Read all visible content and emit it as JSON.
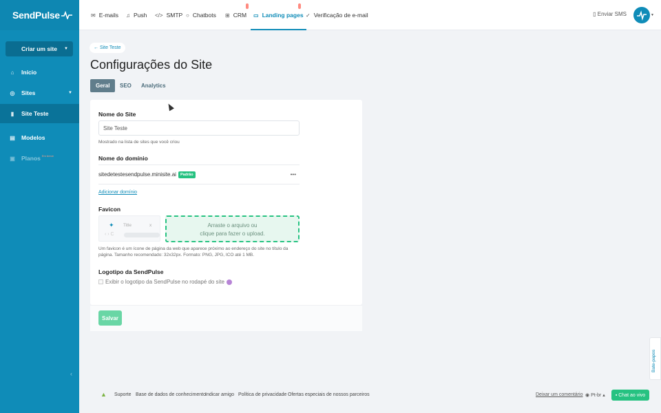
{
  "brand": {
    "name": "SendPulse",
    "accent": "#0f8cb8",
    "sidebar_bg": "#0f8cb8",
    "success": "#26c281"
  },
  "sidebar": {
    "create_label": "Criar um site",
    "items": [
      {
        "label": "Início",
        "icon": "home-icon"
      },
      {
        "label": "Sites",
        "icon": "globe-icon"
      },
      {
        "label": "Site Teste",
        "icon": "site-icon"
      },
      {
        "label": "Modelos",
        "icon": "template-icon"
      },
      {
        "label": "Planos",
        "icon": "plans-icon",
        "badge": "Em breve"
      }
    ]
  },
  "topnav": {
    "tabs": [
      {
        "label": "E-mails",
        "icon": "email-icon"
      },
      {
        "label": "Push",
        "icon": "bell-icon"
      },
      {
        "label": "SMTP",
        "icon": "code-icon"
      },
      {
        "label": "Chatbots",
        "icon": "chat-icon"
      },
      {
        "label": "CRM",
        "icon": "crm-icon"
      },
      {
        "label": "Landing pages",
        "icon": "landing-icon"
      },
      {
        "label": "Verificação de e-mail",
        "icon": "verify-icon"
      }
    ],
    "sms_label": "Enviar SMS"
  },
  "page": {
    "back_label": "← Site Teste",
    "title": "Configurações do Site",
    "tabs": [
      "Geral",
      "SEO",
      "Analytics"
    ]
  },
  "form": {
    "site_name_label": "Nome do Site",
    "site_name_value": "Site Teste",
    "site_name_hint": "Mostrado na lista de sites que você criou",
    "domain_label": "Nome do domínio",
    "domain_value": "sitedetestesendpulse.minisite.ai",
    "domain_badge": "Padrão",
    "domain_menu": "•••",
    "add_domain": "Adicionar domínio",
    "favicon_label": "Favicon",
    "favicon_preview_title": "Title",
    "favicon_preview_close": "x",
    "favicon_preview_nav": "‹ › C",
    "drop_line1": "Arraste o arquivo ou",
    "drop_line2": "clique para fazer o upload.",
    "favicon_hint": "Um favicon é um ícone de página da web que aparece próximo ao endereço do site no título da página. Tamanho recomendado: 32x32px. Formato: PNG, JPG, ICO até 1 MB.",
    "logo_label": "Logotipo da SendPulse",
    "logo_check": "Exibir o logotipo da SendPulse no rodapé do site",
    "save_label": "Salvar"
  },
  "footer": {
    "links": [
      "Suporte",
      "Base de dados de conhecimento",
      "Indicar amigo",
      "Política de privacidade",
      "Ofertas especiais de nossos parceiros"
    ],
    "comment": "Deixar um comentário",
    "lang": "Pt-br",
    "chat": "Chat ao vivo",
    "side_tab": "Bate-papos"
  }
}
